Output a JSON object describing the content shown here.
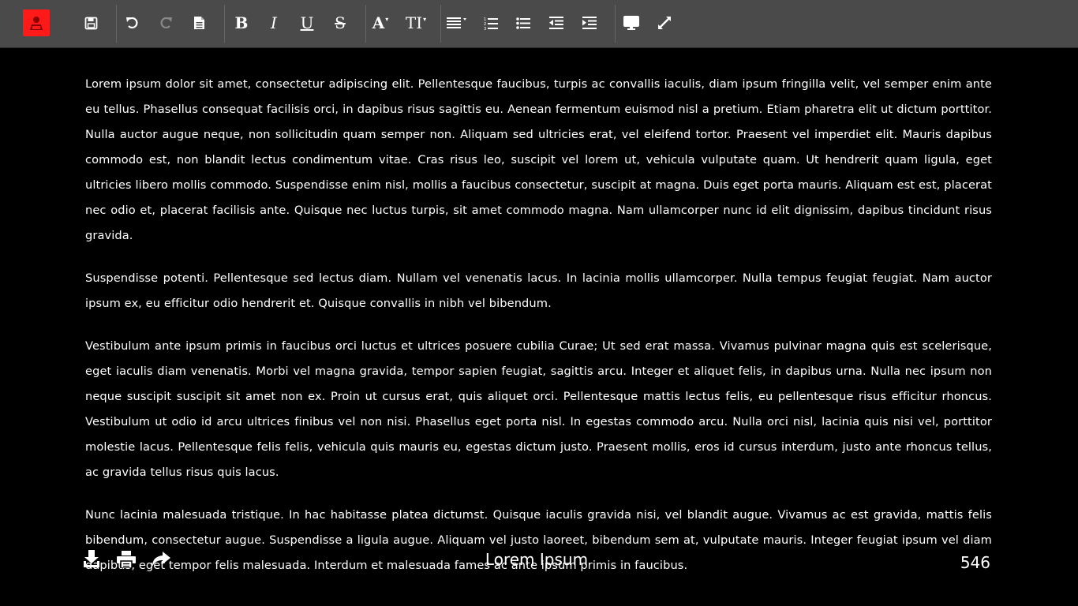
{
  "toolbar": {
    "icons": [
      "user-icon",
      "save-icon",
      "undo-icon",
      "redo-icon",
      "new-document-icon",
      "bold-icon",
      "italic-icon",
      "underline-icon",
      "strikethrough-icon",
      "font-size-icon",
      "text-height-icon",
      "align-icon",
      "ordered-list-icon",
      "unordered-list-icon",
      "outdent-icon",
      "indent-icon",
      "monitor-icon",
      "expand-icon"
    ],
    "bold_glyph": "B",
    "italic_glyph": "I",
    "underline_glyph": "U",
    "strike_glyph": "S",
    "font_size_glyph": "A",
    "text_height_glyph": "TI",
    "logo_color": "#ff1a1a"
  },
  "document": {
    "paragraphs": [
      "Lorem ipsum dolor sit amet, consectetur adipiscing elit. Pellentesque faucibus, turpis ac convallis iaculis, diam ipsum fringilla velit, vel semper enim ante eu tellus. Phasellus consequat facilisis orci, in dapibus risus sagittis eu. Aenean fermentum euismod nisl a pretium. Etiam pharetra elit ut dictum porttitor. Nulla auctor augue neque, non sollicitudin quam semper non. Aliquam sed ultricies erat, vel eleifend tortor. Praesent vel imperdiet elit. Mauris dapibus commodo est, non blandit lectus condimentum vitae. Cras risus leo, suscipit vel lorem ut, vehicula vulputate quam. Ut hendrerit quam ligula, eget ultricies libero mollis commodo. Suspendisse enim nisl, mollis a faucibus consectetur, suscipit at magna. Duis eget porta mauris. Aliquam est est, placerat nec odio et, placerat facilisis ante. Quisque nec luctus turpis, sit amet commodo magna. Nam ullamcorper nunc id elit dignissim, dapibus tincidunt risus gravida.",
      "Suspendisse potenti. Pellentesque sed lectus diam. Nullam vel venenatis lacus. In lacinia mollis ullamcorper. Nulla tempus feugiat feugiat. Nam auctor ipsum ex, eu efficitur odio hendrerit et. Quisque convallis in nibh vel bibendum.",
      "Vestibulum ante ipsum primis in faucibus orci luctus et ultrices posuere cubilia Curae; Ut sed erat massa. Vivamus pulvinar magna quis est scelerisque, eget iaculis diam venenatis. Morbi vel magna gravida, tempor sapien feugiat, sagittis arcu. Integer et aliquet felis, in dapibus urna. Nulla nec ipsum non neque suscipit suscipit sit amet non ex. Proin ut cursus erat, quis aliquet orci. Pellentesque mattis lectus felis, eu pellentesque risus efficitur rhoncus. Vestibulum ut odio id arcu ultrices finibus vel non nisi. Phasellus eget porta nisl. In egestas commodo arcu. Nulla orci nisl, lacinia quis nisi vel, porttitor molestie lacus. Pellentesque felis felis, vehicula quis mauris eu, egestas dictum justo. Praesent mollis, eros id cursus interdum, justo ante rhoncus tellus, ac gravida tellus risus quis lacus.",
      "Nunc lacinia malesuada tristique. In hac habitasse platea dictumst. Quisque iaculis gravida nisi, vel blandit augue. Vivamus ac est gravida, mattis felis bibendum, consectetur augue. Suspendisse a ligula augue. Aliquam vel justo laoreet, bibendum sem at, vulputate mauris. Integer feugiat ipsum vel diam dapibus, eget tempor felis malesuada. Interdum et malesuada fames ac ante ipsum primis in faucibus."
    ]
  },
  "footer": {
    "title": "Lorem Ipsum",
    "word_count": "546",
    "icons": [
      "download-icon",
      "print-icon",
      "share-icon"
    ]
  }
}
